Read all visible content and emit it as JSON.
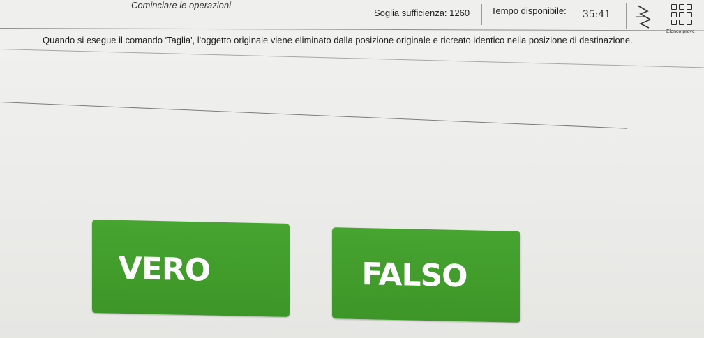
{
  "header": {
    "start_operations": "- Cominciare le operazioni",
    "threshold": "Soglia sufficienza: 1260",
    "time_label": "Tempo disponibile:",
    "time_value": "35:41",
    "list_label": "Elenco prove"
  },
  "question": {
    "text": "Quando si esegue il comando 'Taglia', l'oggetto originale viene eliminato dalla posizione originale e ricreato identico nella posizione di destinazione."
  },
  "answers": {
    "true_label": "VERO",
    "false_label": "FALSO"
  },
  "colors": {
    "answer_green": "#3f9a2a",
    "answer_text": "#ffffff"
  },
  "icons": {
    "nav": "navigation-arrows-icon",
    "list": "grid-list-icon"
  }
}
